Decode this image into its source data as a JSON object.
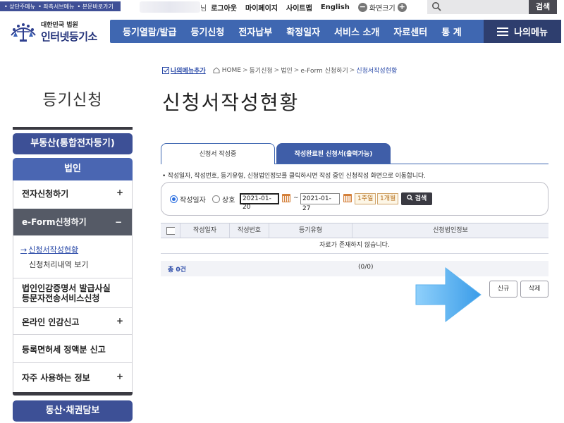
{
  "skip_links": [
    "• 상단주메뉴",
    "• 좌측서브메뉴",
    "• 본문바로가기"
  ],
  "user_bar": {
    "name_suffix": "님",
    "links": [
      "로그아웃",
      "마이페이지",
      "사이트맵",
      "English"
    ],
    "screen_size": "화면크기",
    "minus": "−",
    "plus": "+"
  },
  "search": {
    "placeholder": "",
    "button": "검색"
  },
  "logo": {
    "org": "대한민국 법원",
    "site": "인터넷등기소"
  },
  "gnb": [
    "등기열람/발급",
    "등기신청",
    "전자납부",
    "확정일자",
    "서비스 소개",
    "자료센터",
    "통 계"
  ],
  "my_menu": "나의메뉴",
  "breadcrumb": {
    "add_my_menu": "나의메뉴추가",
    "items": [
      "HOME",
      "등기신청",
      "법인",
      "e-Form 신청하기"
    ],
    "current": "신청서작성현황"
  },
  "sidebar": {
    "title": "등기신청",
    "btn_real_estate": "부동산(통합전자등기)",
    "btn_corp": "법인",
    "items": [
      {
        "label": "전자신청하기",
        "toggle": "+"
      },
      {
        "label": "e-Form신청하기",
        "toggle": "−"
      },
      {
        "label": "법인인감증명서 발급사실 등문자전송서비스신청",
        "toggle": ""
      },
      {
        "label": "온라인 인감신고",
        "toggle": "+"
      },
      {
        "label": "등록면허세 정액분 신고",
        "toggle": ""
      },
      {
        "label": "자주 사용하는 정보",
        "toggle": "+"
      }
    ],
    "sub_items": [
      {
        "arrow": "→",
        "label": "신청서작성현황"
      },
      {
        "label": "신청처리내역 보기"
      }
    ],
    "btn_movable": "동산·채권담보"
  },
  "main": {
    "title": "신청서작성현황",
    "tabs": [
      "신청서 작성중",
      "작성완료된 신청서(출력가능)"
    ],
    "notice": "• 작성일자, 작성번호, 등기유형, 신청법인정보를 클릭하시면 작성 중인 신청작성 화면으로 이동합니다.",
    "filter": {
      "radio_date": "작성일자",
      "radio_name": "상호",
      "date_from": "2021-01-20",
      "tilde": "~",
      "date_to": "2021-01-27",
      "period_week": "1주일",
      "period_month": "1개월",
      "search_btn": "검색"
    },
    "table": {
      "columns": [
        "",
        "작성일자",
        "작성번호",
        "등기유형",
        "신청법인정보"
      ],
      "empty_message": "자료가 존재하지 않습니다."
    },
    "summary": {
      "total": "총 0건",
      "pages": "(0/0)"
    },
    "buttons": {
      "new": "신규",
      "delete": "삭제"
    }
  },
  "colors": {
    "gnb": "#3f67b1",
    "my_menu": "#2e3e6e",
    "side_button": "#3d5096",
    "side_active": "#555a66",
    "arrow": "#4aa8ec"
  }
}
